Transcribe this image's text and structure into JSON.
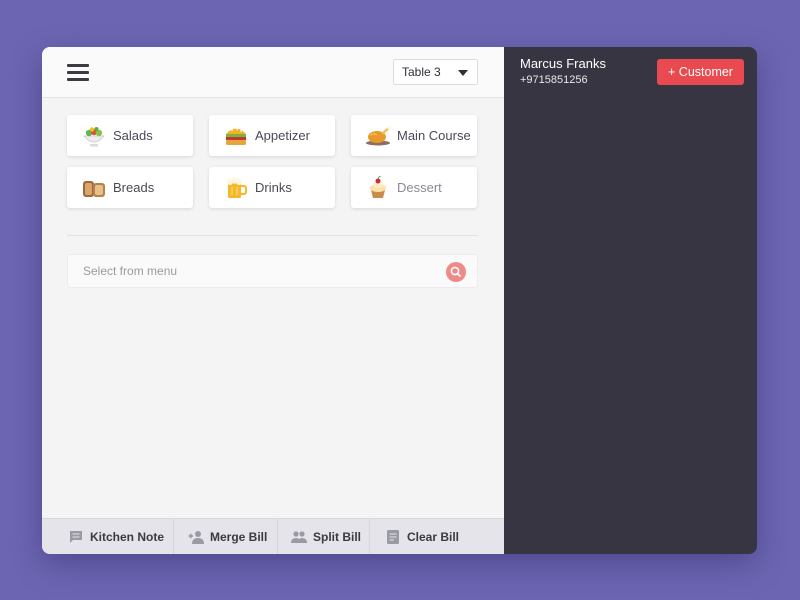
{
  "colors": {
    "background": "#6c66b2",
    "panel": "#f4f4f5",
    "sidebar": "#363541",
    "accent": "#e84a4f",
    "search_icon": "#ee8a8a"
  },
  "header": {
    "menu_icon": "hamburger-icon",
    "table_select": {
      "value": "Table 3"
    }
  },
  "categories": [
    {
      "label": "Salads",
      "icon": "salad-icon"
    },
    {
      "label": "Appetizer",
      "icon": "sandwich-icon"
    },
    {
      "label": "Main Course",
      "icon": "roast-chicken-icon"
    },
    {
      "label": "Breads",
      "icon": "bread-icon"
    },
    {
      "label": "Drinks",
      "icon": "beer-icon"
    },
    {
      "label": "Dessert",
      "icon": "cupcake-icon"
    }
  ],
  "search": {
    "placeholder": "Select from menu",
    "icon": "search-icon"
  },
  "actions": {
    "kitchen_note": "Kitchen Note",
    "merge_bill": "Merge Bill",
    "split_bill": "Split Bill",
    "clear_bill": "Clear Bill"
  },
  "customer": {
    "name": "Marcus Franks",
    "phone": "+9715851256",
    "add_label": "+ Customer"
  }
}
